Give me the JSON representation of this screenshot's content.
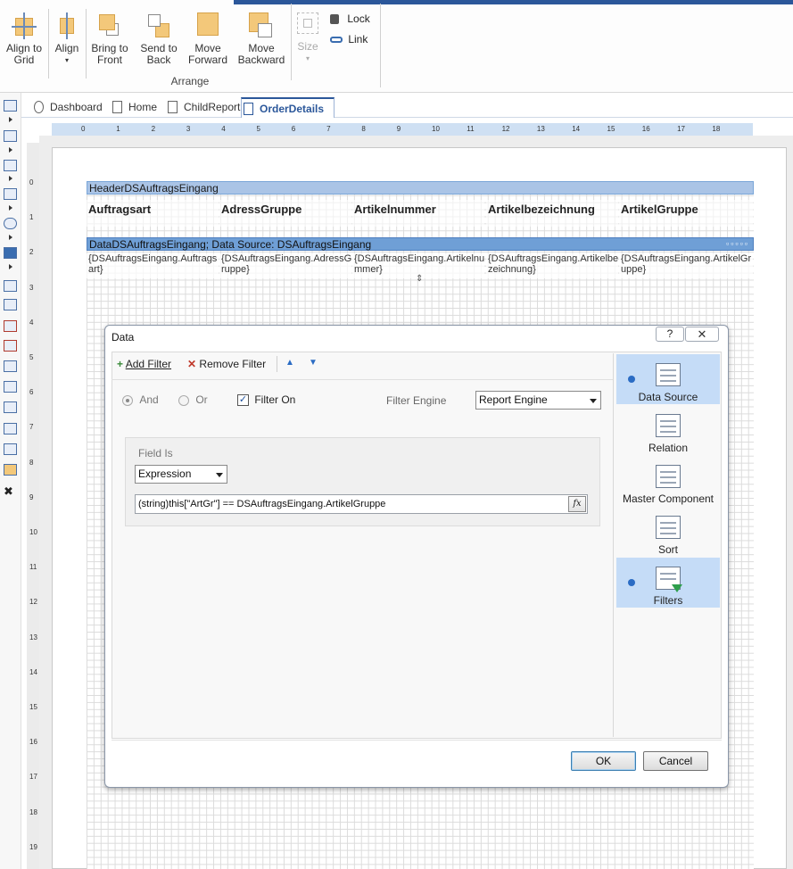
{
  "ribbon": {
    "buttons": [
      {
        "label_1": "Align to",
        "label_2": "Grid"
      },
      {
        "label_1": "Align",
        "label_2": ""
      },
      {
        "label_1": "Bring to",
        "label_2": "Front"
      },
      {
        "label_1": "Send to",
        "label_2": "Back"
      },
      {
        "label_1": "Move",
        "label_2": "Forward"
      },
      {
        "label_1": "Move",
        "label_2": "Backward"
      }
    ],
    "size_label": "Size",
    "lock_label": "Lock",
    "link_label": "Link",
    "group_label": "Arrange"
  },
  "tabs": [
    {
      "label": "Dashboard"
    },
    {
      "label": "Home"
    },
    {
      "label": "ChildReport"
    },
    {
      "label": "OrderDetails"
    }
  ],
  "ruler": {
    "h": [
      "0",
      "1",
      "2",
      "3",
      "4",
      "5",
      "6",
      "7",
      "8",
      "9",
      "10",
      "11",
      "12",
      "13",
      "14",
      "15",
      "16",
      "17",
      "18"
    ],
    "v": [
      "0",
      "1",
      "2",
      "3",
      "4",
      "5",
      "6",
      "7",
      "8",
      "9",
      "10",
      "11",
      "12",
      "13",
      "14",
      "15",
      "16",
      "17",
      "18",
      "19"
    ]
  },
  "report": {
    "header_band": "HeaderDSAuftragsEingang",
    "header_cells": [
      "Auftragsart",
      "AdressGruppe",
      "Artikelnummer",
      "Artikelbezeichnung",
      "ArtikelGruppe"
    ],
    "data_band": "DataDSAuftragsEingang; Data Source: DSAuftragsEingang",
    "data_cells": [
      {
        "l1": "{DSAuftragsEingang.Auftrags",
        "l2": "art}"
      },
      {
        "l1": "{DSAuftragsEingang.AdressG",
        "l2": "ruppe}"
      },
      {
        "l1": "{DSAuftragsEingang.Artikelnu",
        "l2": "mmer}"
      },
      {
        "l1": "{DSAuftragsEingang.Artikelbe",
        "l2": "zeichnung}"
      },
      {
        "l1": "{DSAuftragsEingang.ArtikelGr",
        "l2": "uppe}"
      }
    ]
  },
  "dialog": {
    "title": "Data",
    "help": "?",
    "add_filter": "Add Filter",
    "remove_filter": "Remove Filter",
    "and_label": "And",
    "or_label": "Or",
    "filter_on_label": "Filter On",
    "filter_on_checked": true,
    "filter_engine_label": "Filter Engine",
    "filter_engine_value": "Report Engine",
    "field_is_label": "Field Is",
    "field_is_value": "Expression",
    "expression": "(string)this[\"ArtGr\"] == DSAuftragsEingang.ArtikelGruppe",
    "fx": "fx",
    "ok": "OK",
    "cancel": "Cancel",
    "nav": [
      {
        "label": "Data Source",
        "active": true
      },
      {
        "label": "Relation",
        "active": false
      },
      {
        "label": "Master Component",
        "active": false
      },
      {
        "label": "Sort",
        "active": false
      },
      {
        "label": "Filters",
        "active": true
      }
    ]
  },
  "colors": {
    "accent": "#2b579a",
    "band": "#7aa6d8",
    "selected_nav": "#c5dcf7"
  }
}
